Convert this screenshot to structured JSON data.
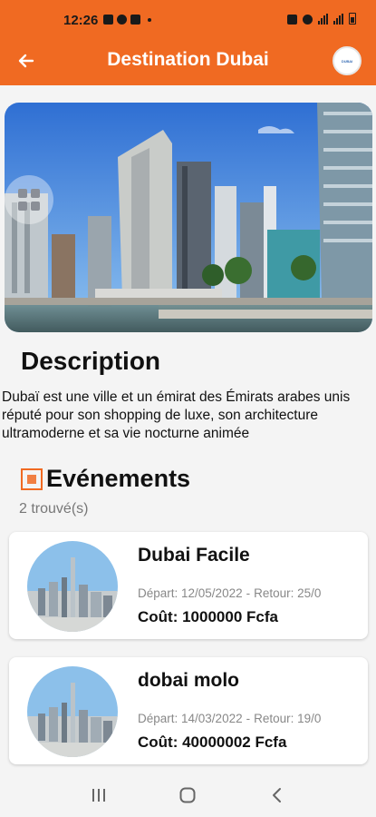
{
  "status_bar": {
    "time": "12:26"
  },
  "app_bar": {
    "title": "Destination Dubai",
    "logo_text": "DUBAI"
  },
  "description": {
    "heading": "Description",
    "text": "Dubaï est une ville et un émirat des Émirats arabes unis réputé pour son shopping de luxe, son architecture ultramoderne et sa vie nocturne animée"
  },
  "events": {
    "heading": "Evénements",
    "count_text": "2 trouvé(s)",
    "items": [
      {
        "name": "Dubai Facile",
        "depart": "Départ: 12/05/2022",
        "retour": "Retour: 25/0",
        "cost": "Coût: 1000000 Fcfa"
      },
      {
        "name": "dobai molo",
        "depart": "Départ: 14/03/2022",
        "retour": "Retour: 19/0",
        "cost": "Coût: 40000002 Fcfa"
      }
    ]
  },
  "colors": {
    "accent": "#f06a22",
    "background": "#f4f4f4"
  },
  "icons": {
    "back": "arrow-left-icon",
    "gallery": "grid-icon",
    "events": "event-square-icon",
    "nav_recents": "recents-icon",
    "nav_home": "home-icon",
    "nav_back": "chevron-left-icon"
  }
}
